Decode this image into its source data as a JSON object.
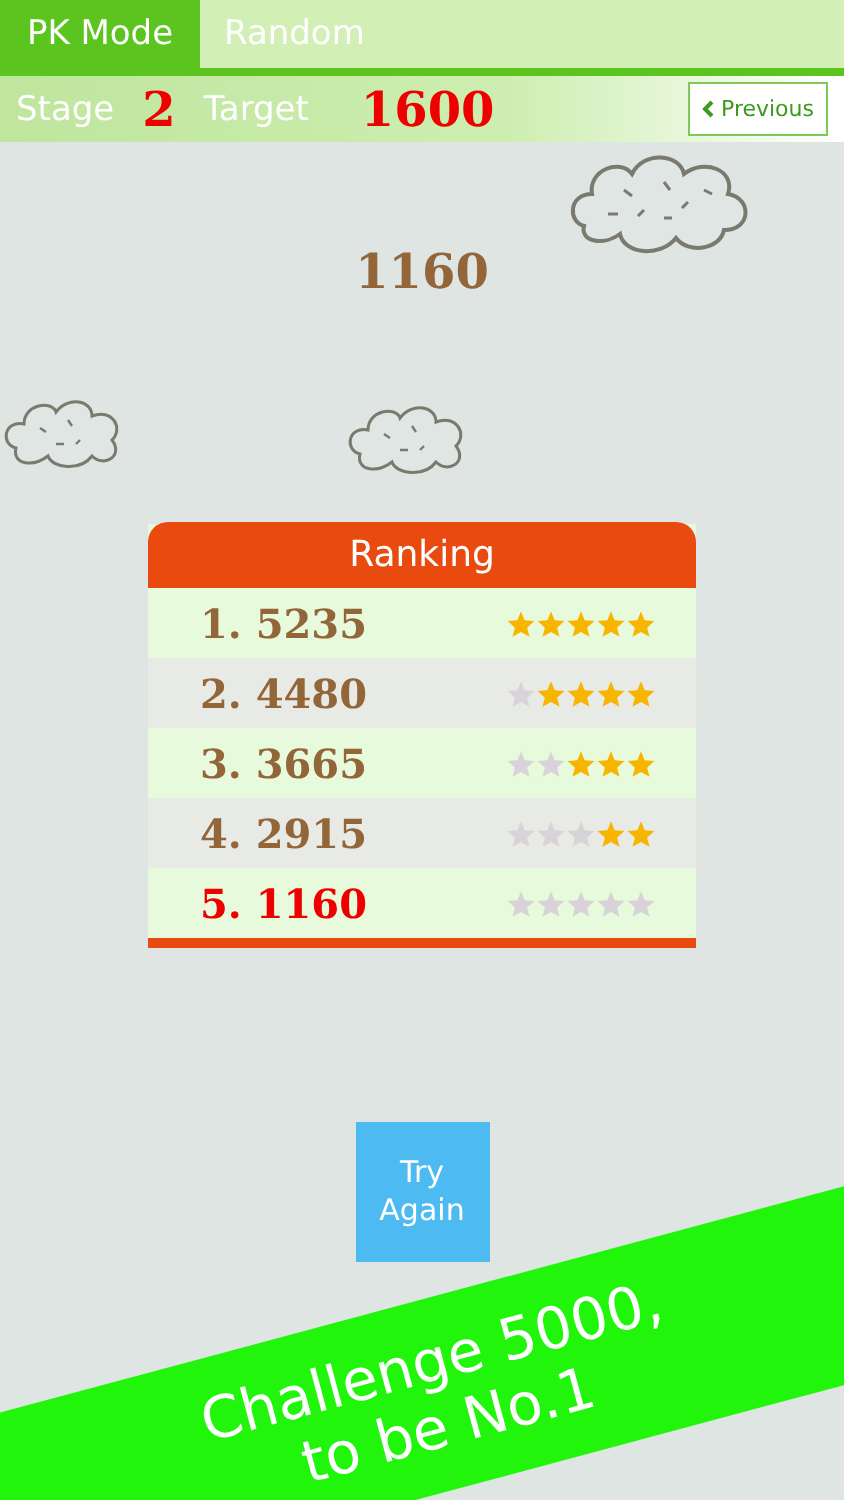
{
  "tabs": [
    {
      "label": "PK Mode",
      "selected": true
    },
    {
      "label": "Random",
      "selected": false
    }
  ],
  "stage_bar": {
    "stage_label": "Stage",
    "stage": "2",
    "target_label": "Target",
    "target": "1600",
    "previous_button": "Previous"
  },
  "score": "1160",
  "ranking": {
    "title": "Ranking",
    "rows": [
      {
        "entry": "1. 5235",
        "stars": 5,
        "current": false
      },
      {
        "entry": "2. 4480",
        "stars": 4,
        "current": false
      },
      {
        "entry": "3. 3665",
        "stars": 3,
        "current": false
      },
      {
        "entry": "4. 2915",
        "stars": 2,
        "current": false
      },
      {
        "entry": "5. 1160",
        "stars": 0,
        "current": true
      }
    ]
  },
  "try_again_button": "Try Again",
  "banner": {
    "lines": [
      "Challenge 5000,",
      "to be No.1"
    ]
  }
}
